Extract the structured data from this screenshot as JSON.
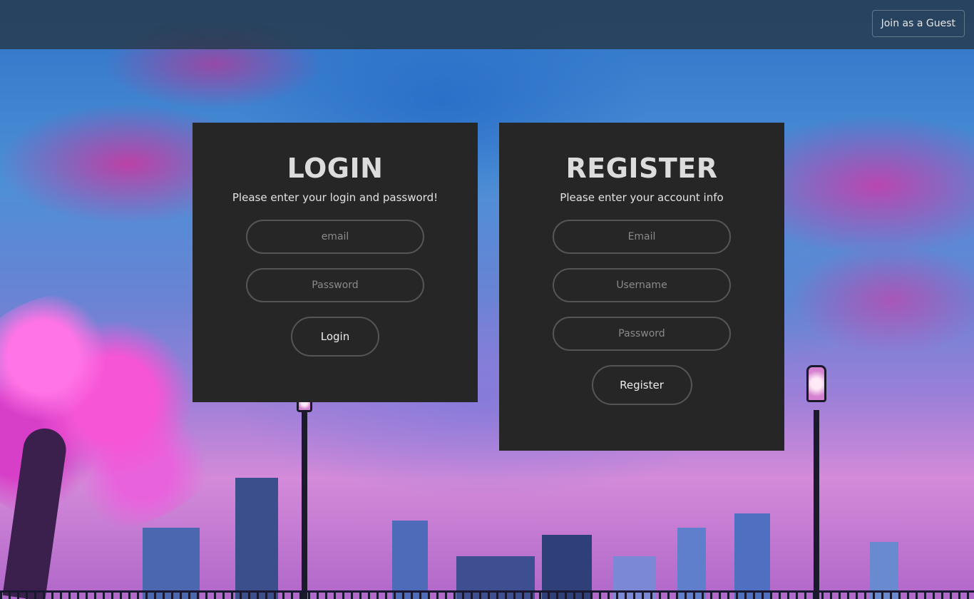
{
  "header": {
    "guest_button_label": "Join as a Guest"
  },
  "login": {
    "title": "LOGIN",
    "subtitle": "Please enter your login and password!",
    "email_placeholder": "email",
    "password_placeholder": "Password",
    "submit_label": "Login"
  },
  "register": {
    "title": "REGISTER",
    "subtitle": "Please enter your account info",
    "email_placeholder": "Email",
    "username_placeholder": "Username",
    "password_placeholder": "Password",
    "submit_label": "Register"
  },
  "colors": {
    "panel_background": "#262626",
    "header_background": "#263848",
    "field_border": "#555555"
  }
}
